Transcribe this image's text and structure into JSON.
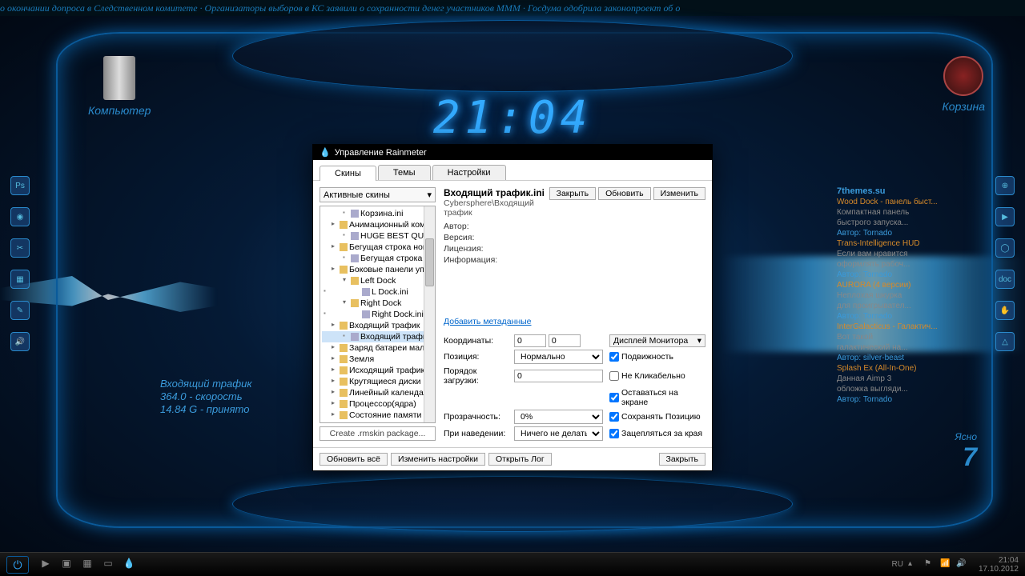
{
  "ticker": "о окончании допроса в Следственном комитете · Организаторы выборов в КС заявили о сохранности денег участников МММ · Госдума одобрила законопроект об о",
  "clock": "21:04",
  "desktop_icons": {
    "computer": "Компьютер",
    "trash": "Корзина"
  },
  "traffic": {
    "title": "Входящий трафик",
    "speed": "364.0 - скорость",
    "received": "14.84 G   - принято"
  },
  "weather": {
    "label": "Ясно",
    "temp": "7"
  },
  "feed": {
    "site": "7themes.su",
    "items": [
      {
        "t": "Wood Dock - панель быст...",
        "s": "Компактная панель",
        "s2": "быстрого запуска...",
        "a": "Автор: Tornado"
      },
      {
        "t": "Trans-Intelligence HUD",
        "s": "Если вам нравится",
        "s2": "оформлять рабоч...",
        "a": "Автор: Tornado"
      },
      {
        "t": "AURORA (4 версии)",
        "s": "Неплохая шкурка",
        "s2": "для проигрывател...",
        "a": "Автор: Tornado"
      },
      {
        "t": "InterGalacticus - Галактич...",
        "s": "Вот такой",
        "s2": "галактический на...",
        "a": "Автор: silver-beast"
      },
      {
        "t": "Splash Ex (All-In-One)",
        "s": "Данная Aimp 3",
        "s2": "обложка выгляди...",
        "a": "Автор: Tornado"
      }
    ]
  },
  "rm": {
    "title": "Управление Rainmeter",
    "tabs": {
      "skins": "Скины",
      "themes": "Темы",
      "settings": "Настройки"
    },
    "active_dropdown": "Активные скины",
    "tree": [
      {
        "d": 3,
        "t": "Корзина.ini",
        "file": true
      },
      {
        "d": 2,
        "t": "Анимационный компью"
      },
      {
        "d": 3,
        "t": "HUGE BEST QUALITY.i",
        "file": true
      },
      {
        "d": 2,
        "t": "Бегущая строка новосте"
      },
      {
        "d": 3,
        "t": "Бегущая строка ново",
        "file": true
      },
      {
        "d": 2,
        "t": "Боковые панели управле"
      },
      {
        "d": 3,
        "t": "Left Dock"
      },
      {
        "d": 4,
        "t": "L Dock.ini",
        "file": true
      },
      {
        "d": 3,
        "t": "Right Dock"
      },
      {
        "d": 4,
        "t": "Right Dock.ini",
        "file": true
      },
      {
        "d": 2,
        "t": "Входящий трафик"
      },
      {
        "d": 3,
        "t": "Входящий трафик.ini",
        "file": true,
        "sel": true
      },
      {
        "d": 2,
        "t": "Заряд батареи маленьки"
      },
      {
        "d": 2,
        "t": "Земля"
      },
      {
        "d": 2,
        "t": "Исходящий трафик"
      },
      {
        "d": 2,
        "t": "Крутящиеся диски"
      },
      {
        "d": 2,
        "t": "Линейный календарь"
      },
      {
        "d": 2,
        "t": "Процессор(ядра)"
      },
      {
        "d": 2,
        "t": "Состояние памяти"
      }
    ],
    "create": "Create .rmskin package...",
    "skin_title": "Входящий трафик.ini",
    "skin_path": "Cybersphere\\Входящий трафик",
    "meta": {
      "author": "Автор:",
      "version": "Версия:",
      "license": "Лицензия:",
      "info": "Информация:"
    },
    "link": "Добавить метаданные",
    "buttons": {
      "close": "Закрыть",
      "refresh": "Обновить",
      "edit": "Изменить"
    },
    "fields": {
      "coords": "Координаты:",
      "coords_x": "0",
      "coords_y": "0",
      "monitor": "Дисплей Монитора",
      "position": "Позиция:",
      "position_val": "Нормально",
      "load_order": "Порядок загрузки:",
      "load_order_val": "0",
      "transparency": "Прозрачность:",
      "transparency_val": "0%",
      "on_hover": "При наведении:",
      "on_hover_val": "Ничего не делать",
      "chk_mobility": "Подвижность",
      "chk_noclick": "Не Кликабельно",
      "chk_stay": "Оставаться на экране",
      "chk_savepos": "Сохранять Позицию",
      "chk_snap": "Зацепляться за края"
    },
    "footer": {
      "refresh_all": "Обновить всё",
      "edit_settings": "Изменить настройки",
      "open_log": "Открыть Лог",
      "close": "Закрыть"
    }
  },
  "taskbar": {
    "lang": "RU",
    "time": "21:04",
    "date": "17.10.2012"
  }
}
